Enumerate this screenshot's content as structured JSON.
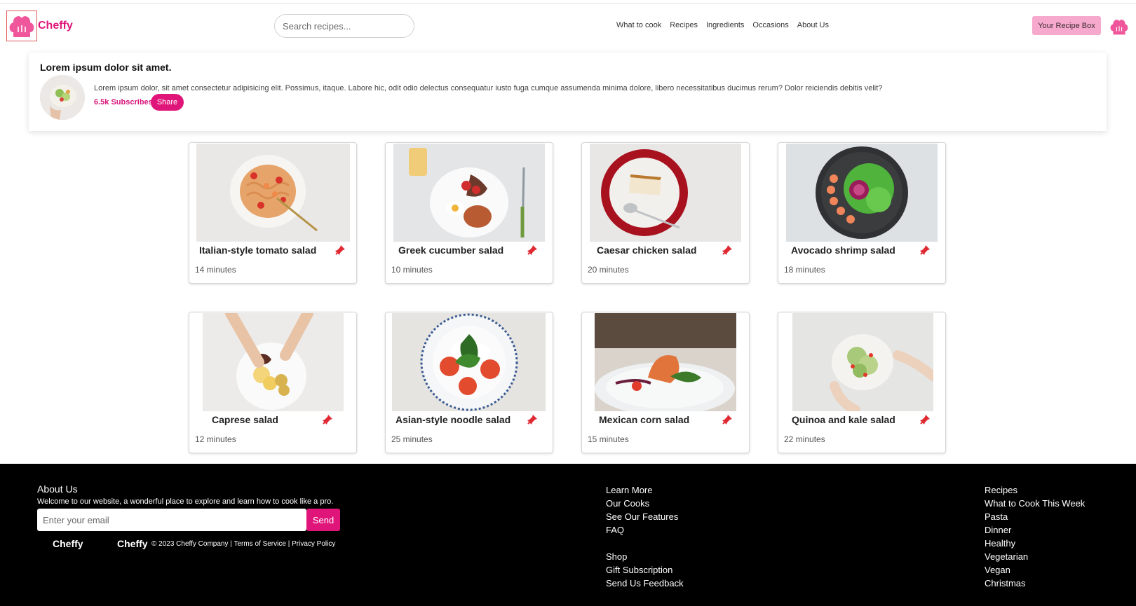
{
  "header": {
    "brand": "Cheffy",
    "search_placeholder": "Search recipes...",
    "nav": [
      "What to cook",
      "Recipes",
      "Ingredients",
      "Occasions",
      "About Us"
    ],
    "recipe_box_label": "Your Recipe Box"
  },
  "profile": {
    "title": "Lorem ipsum dolor sit amet.",
    "description": "Lorem ipsum dolor, sit amet consectetur adipisicing elit. Possimus, itaque. Labore hic, odit odio delectus consequatur iusto fuga cumque assumenda minima dolore, libero necessitatibus ducimus rerum? Dolor reiciendis debitis velit?",
    "subscribers": "6.5k Subscribes",
    "share_label": "Share"
  },
  "recipes": [
    {
      "title": "Italian-style tomato salad",
      "time": "14 minutes"
    },
    {
      "title": "Greek cucumber salad",
      "time": "10 minutes"
    },
    {
      "title": "Caesar chicken salad",
      "time": "20 minutes"
    },
    {
      "title": "Avocado shrimp salad",
      "time": "18 minutes"
    },
    {
      "title": "Caprese salad",
      "time": "12 minutes"
    },
    {
      "title": "Asian-style noodle salad",
      "time": "25 minutes"
    },
    {
      "title": "Mexican corn salad",
      "time": "15 minutes"
    },
    {
      "title": "Quinoa and kale salad",
      "time": "22 minutes"
    }
  ],
  "footer": {
    "about_title": "About Us",
    "about_text": "Welcome to our website, a wonderful place to explore and learn how to cook like a pro.",
    "email_placeholder": "Enter your email",
    "send_label": "Send",
    "brand": "Cheffy",
    "copyright": "© 2023 Cheffy Company |",
    "terms": "Terms of Service",
    "separator": "|",
    "privacy": "Privacy Policy",
    "col1": [
      "Learn More",
      "Our Cooks",
      "See Our Features",
      "FAQ"
    ],
    "col1b": [
      "Shop",
      "Gift Subscription",
      "Send Us Feedback"
    ],
    "col2": [
      "Recipes",
      "What to Cook This Week",
      "Pasta",
      "Dinner",
      "Healthy",
      "Vegetarian",
      "Vegan",
      "Christmas"
    ]
  },
  "colors": {
    "accent": "#e0157a",
    "accent_light": "#f7a8cd",
    "footer_bg": "#000000"
  }
}
